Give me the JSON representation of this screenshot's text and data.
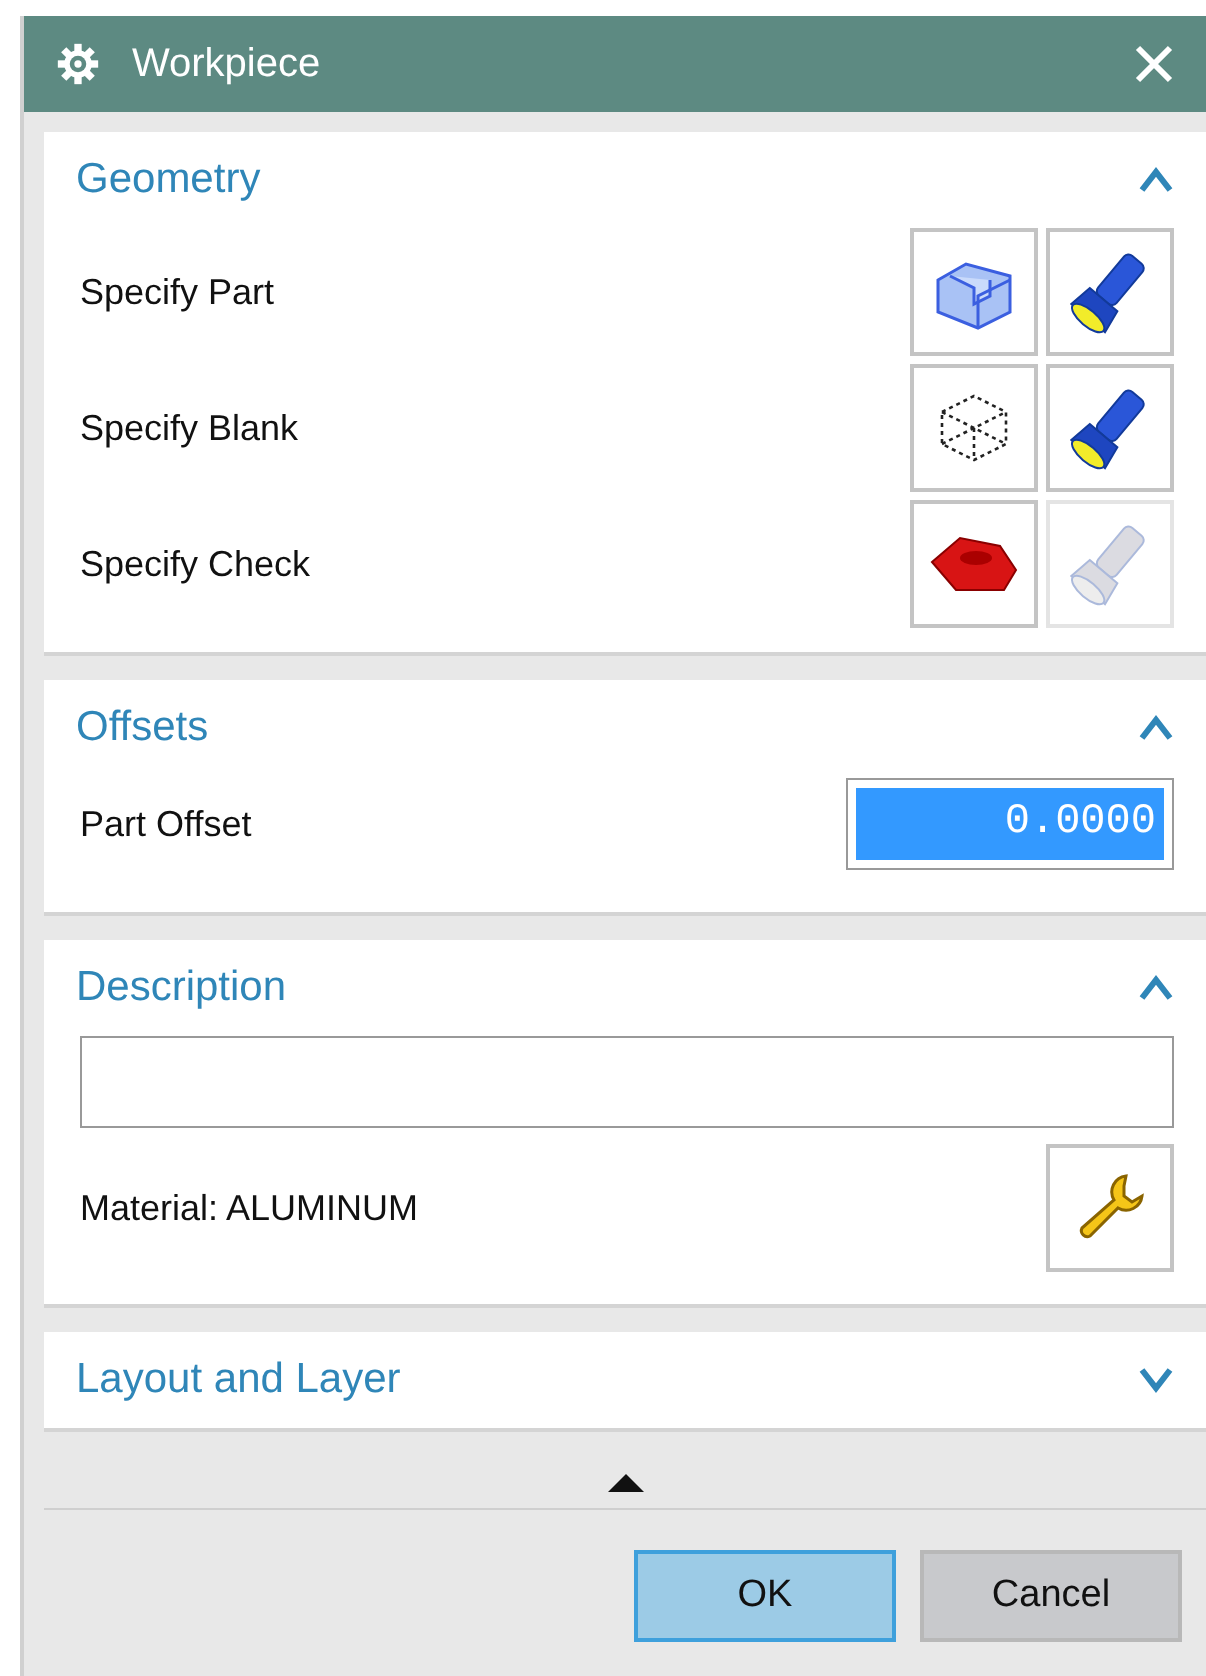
{
  "window": {
    "title": "Workpiece"
  },
  "sections": [
    {
      "kind": "geometry",
      "title": "Geometry",
      "expanded": true,
      "rows": [
        {
          "label": "Specify Part",
          "kind": "part",
          "display_disabled": false
        },
        {
          "label": "Specify Blank",
          "kind": "blank",
          "display_disabled": false
        },
        {
          "label": "Specify Check",
          "kind": "check",
          "display_disabled": true
        }
      ]
    },
    {
      "kind": "offsets",
      "title": "Offsets",
      "expanded": true,
      "fields": [
        {
          "label": "Part Offset",
          "value": "0.0000",
          "selected": true
        }
      ]
    },
    {
      "kind": "description",
      "title": "Description",
      "expanded": true,
      "material": "Material: ALUMINUM"
    },
    {
      "title": "Layout and Layer",
      "expanded": false
    }
  ],
  "buttons": [
    {
      "label": "OK",
      "default": true
    },
    {
      "label": "Cancel",
      "default": false
    }
  ]
}
